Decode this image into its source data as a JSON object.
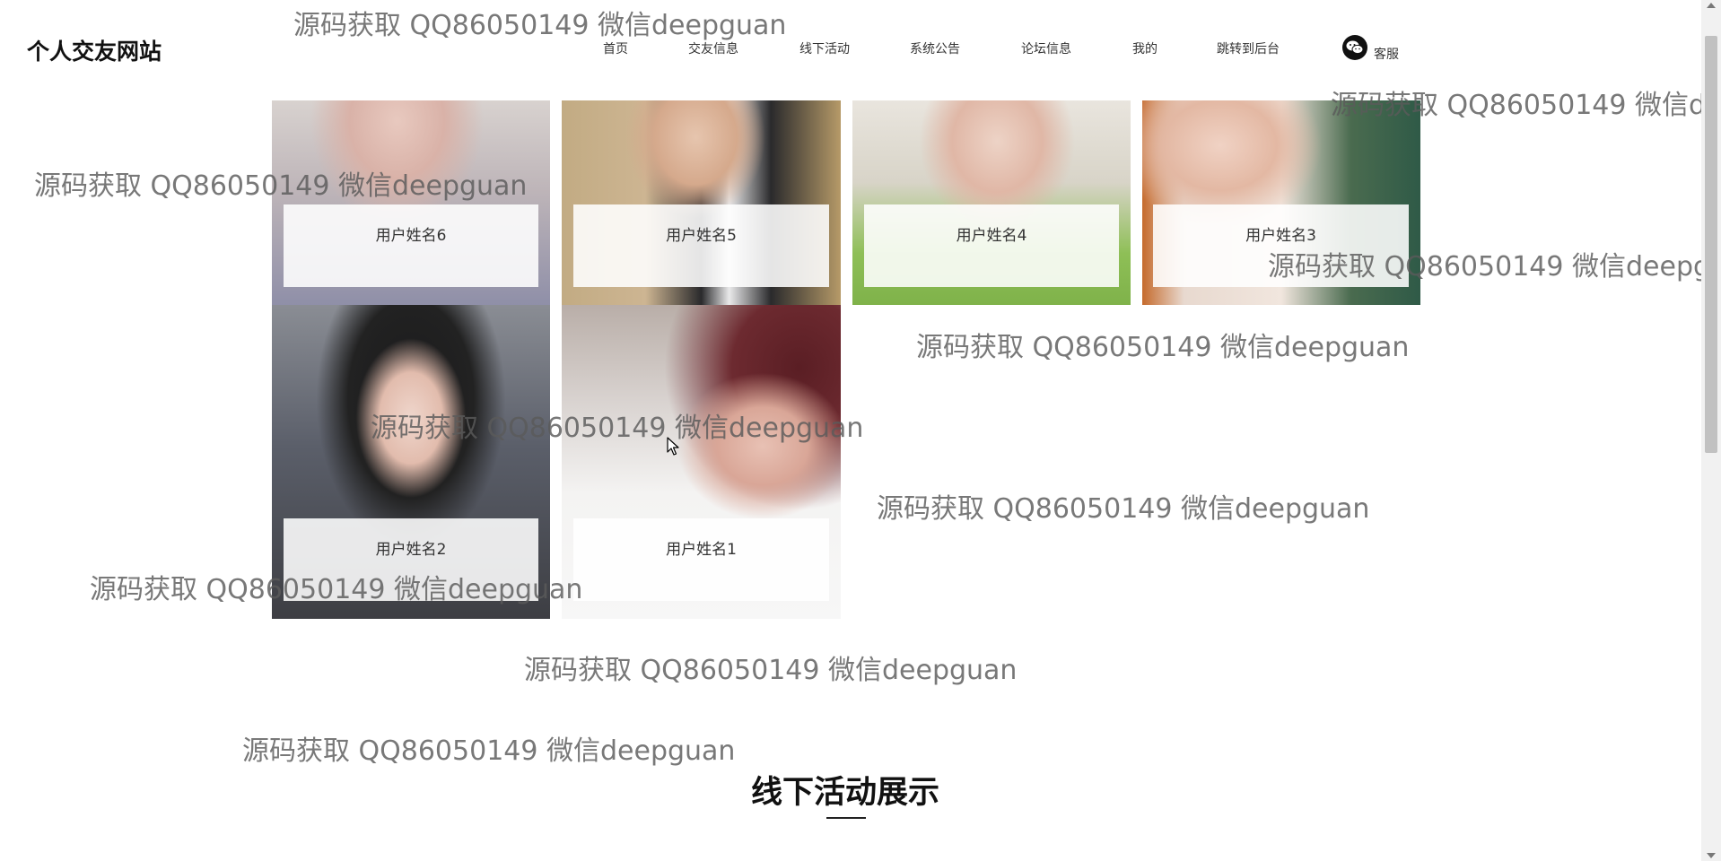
{
  "header": {
    "site_title": "个人交友网站",
    "nav": [
      {
        "label": "首页"
      },
      {
        "label": "交友信息"
      },
      {
        "label": "线下活动"
      },
      {
        "label": "系统公告"
      },
      {
        "label": "论坛信息"
      },
      {
        "label": "我的"
      },
      {
        "label": "跳转到后台"
      }
    ],
    "customer_service": "客服"
  },
  "users": [
    {
      "name": "用户姓名6"
    },
    {
      "name": "用户姓名5"
    },
    {
      "name": "用户姓名4"
    },
    {
      "name": "用户姓名3"
    },
    {
      "name": "用户姓名2"
    },
    {
      "name": "用户姓名1"
    }
  ],
  "section": {
    "title": "线下活动展示"
  },
  "watermark": "源码获取 QQ86050149 微信deepguan",
  "watermark_cut": "源码获取 QQ86050149 微信dee",
  "watermark_cut2": "源码获取 QQ86050149 微信deepgua",
  "icons": {
    "wechat": "wechat-icon",
    "cursor": "mouse-cursor-icon"
  }
}
